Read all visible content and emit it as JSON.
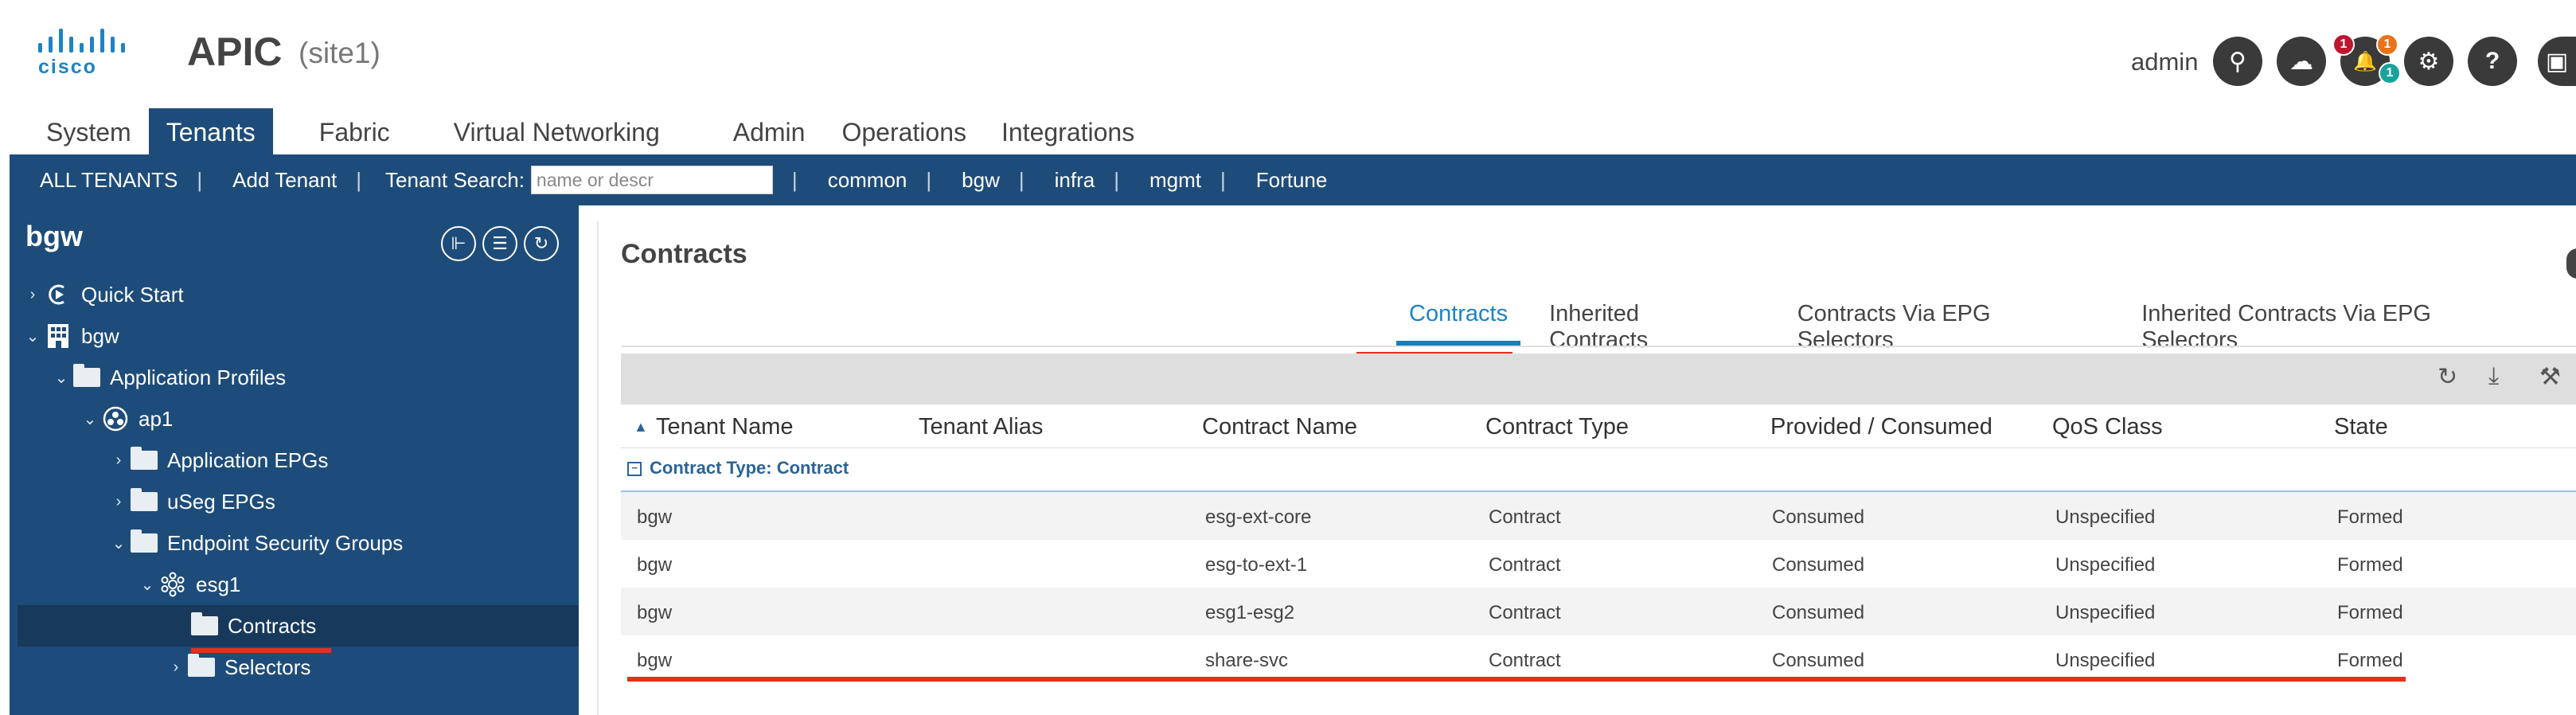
{
  "header": {
    "logo_text": "cisco",
    "app_name": "APIC",
    "site": "(site1)",
    "user": "admin",
    "icons": [
      {
        "name": "search-icon",
        "glyph": "⚲"
      },
      {
        "name": "cloud-icon",
        "glyph": "☁"
      },
      {
        "name": "bell-icon",
        "glyph": "🔔"
      },
      {
        "name": "gear-icon",
        "glyph": "⚙"
      },
      {
        "name": "help-icon",
        "glyph": "?"
      },
      {
        "name": "screen-icon",
        "glyph": "▣"
      }
    ],
    "badges": {
      "critical": "1",
      "major": "1",
      "minor": "1"
    },
    "badge_colors": {
      "critical": "#c0152f",
      "major": "#e8731a",
      "minor": "#1aa39a"
    }
  },
  "main_tabs": [
    "System",
    "Tenants",
    "Fabric",
    "Virtual Networking",
    "Admin",
    "Operations",
    "Integrations"
  ],
  "active_main_tab": "Tenants",
  "subnav": {
    "all_tenants": "ALL TENANTS",
    "add_tenant": "Add Tenant",
    "search_label": "Tenant Search:",
    "search_placeholder": "name or descr",
    "tenants": [
      "common",
      "bgw",
      "infra",
      "mgmt",
      "Fortune"
    ]
  },
  "tree": {
    "title": "bgw",
    "nodes": [
      {
        "label": "Quick Start",
        "chevron": "›",
        "icon": "quickstart-icon"
      },
      {
        "label": "bgw",
        "chevron": "⌄",
        "icon": "tenant-icon"
      },
      {
        "label": "Application Profiles",
        "chevron": "⌄",
        "icon": "folder-icon"
      },
      {
        "label": "ap1",
        "chevron": "⌄",
        "icon": "app-profile-icon"
      },
      {
        "label": "Application EPGs",
        "chevron": "›",
        "icon": "folder-icon"
      },
      {
        "label": "uSeg EPGs",
        "chevron": "›",
        "icon": "folder-icon"
      },
      {
        "label": "Endpoint Security Groups",
        "chevron": "⌄",
        "icon": "folder-icon"
      },
      {
        "label": "esg1",
        "chevron": "⌄",
        "icon": "esg-icon"
      },
      {
        "label": "Contracts",
        "chevron": "",
        "icon": "folder-icon"
      },
      {
        "label": "Selectors",
        "chevron": "›",
        "icon": "folder-icon"
      }
    ]
  },
  "panel": {
    "title": "Contracts",
    "tabs": [
      "Contracts",
      "Inherited Contracts",
      "Contracts Via EPG Selectors",
      "Inherited Contracts Via EPG Selectors"
    ],
    "active_tab": "Contracts",
    "toolbar_icons": [
      "refresh-icon",
      "download-icon",
      "tools-icon"
    ],
    "columns": [
      "Tenant Name",
      "Tenant Alias",
      "Contract Name",
      "Contract Type",
      "Provided / Consumed",
      "QoS Class",
      "State"
    ],
    "sort_indicator": "▲",
    "group_toggle": "−",
    "group_label": "Contract Type: Contract",
    "rows": [
      [
        "bgw",
        "",
        "esg-ext-core",
        "Contract",
        "Consumed",
        "Unspecified",
        "Formed"
      ],
      [
        "bgw",
        "",
        "esg-to-ext-1",
        "Contract",
        "Consumed",
        "Unspecified",
        "Formed"
      ],
      [
        "bgw",
        "",
        "esg1-esg2",
        "Contract",
        "Consumed",
        "Unspecified",
        "Formed"
      ],
      [
        "bgw",
        "",
        "share-svc",
        "Contract",
        "Consumed",
        "Unspecified",
        "Formed"
      ]
    ]
  },
  "colors": {
    "nav_blue": "#1e4c7a",
    "accent_blue": "#1d83c4",
    "highlight_red": "#e5301a"
  }
}
